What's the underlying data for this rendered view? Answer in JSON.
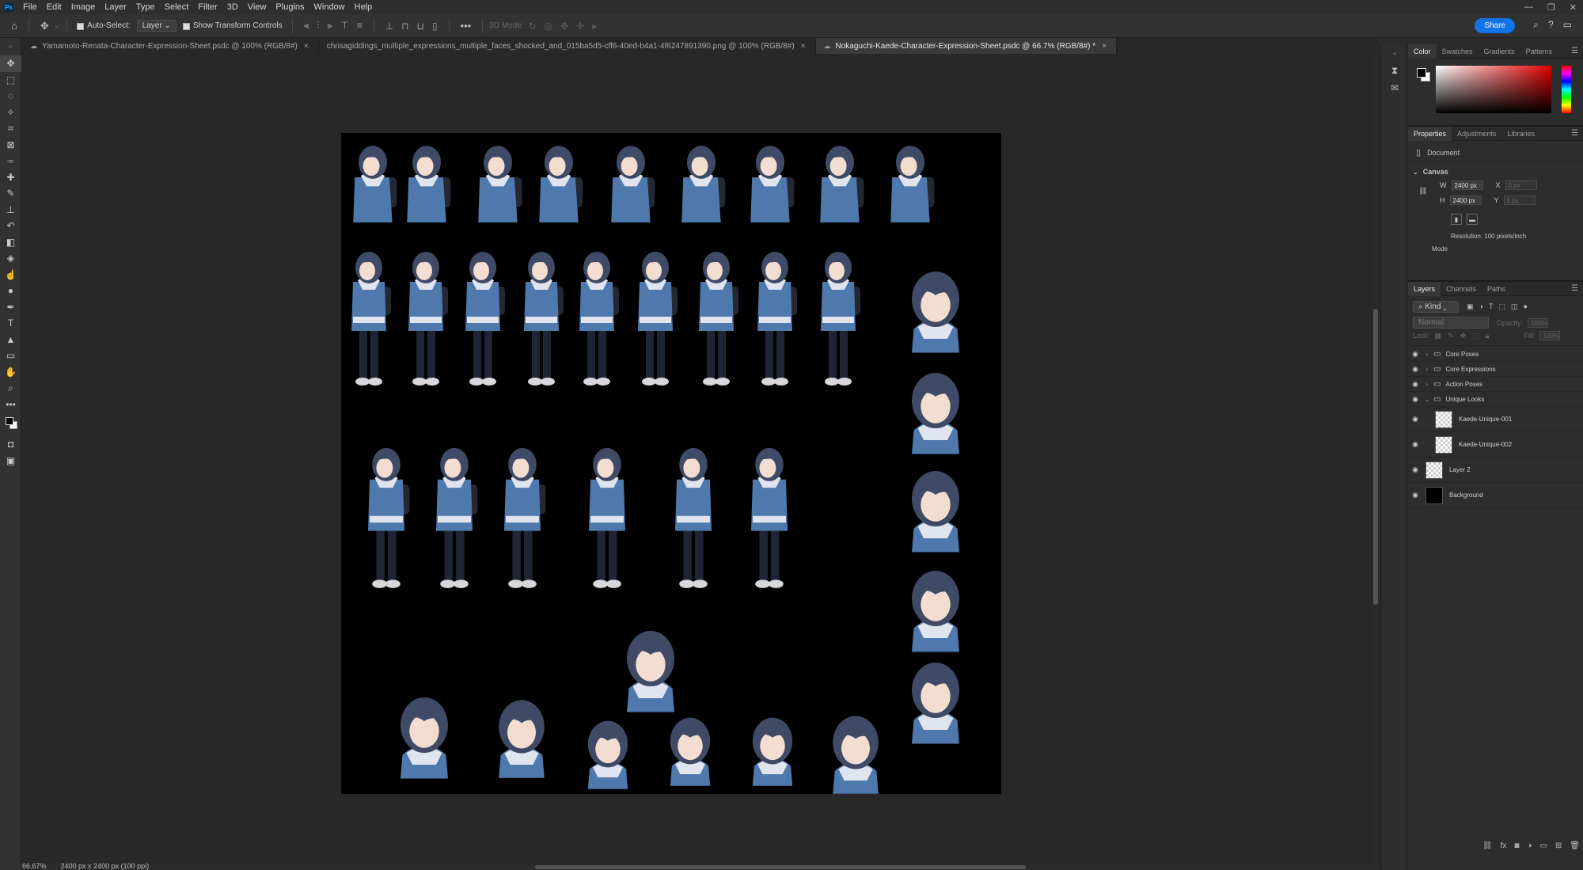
{
  "menu": [
    "File",
    "Edit",
    "Image",
    "Layer",
    "Type",
    "Select",
    "Filter",
    "3D",
    "View",
    "Plugins",
    "Window",
    "Help"
  ],
  "options": {
    "auto_select_label": "Auto-Select:",
    "auto_select_value": "Layer",
    "transform_label": "Show Transform Controls",
    "mode_3d": "3D Mode:",
    "share_label": "Share"
  },
  "tabs": [
    {
      "label": "Yamamoto-Renata-Character-Expression-Sheet.psdc @ 100% (RGB/8#)",
      "close": "×"
    },
    {
      "label": "chrisagiddings_multiple_expressions_multiple_faces_shocked_and_015ba5d5-cff6-40ed-b4a1-4f6247891390.png @ 100% (RGB/8#)",
      "close": "×"
    },
    {
      "label": "Nokaguchi-Kaede-Character-Expression-Sheet.psdc @ 66.7% (RGB/8#) *",
      "close": "×"
    }
  ],
  "status": {
    "zoom": "66.67%",
    "doc_info": "2400 px x 2400 px (100 ppi)"
  },
  "color_panel": {
    "tabs": [
      "Color",
      "Swatches",
      "Gradients",
      "Patterns"
    ]
  },
  "properties_panel": {
    "tabs": [
      "Properties",
      "Adjustments",
      "Libraries"
    ],
    "doc_label": "Document",
    "section": "Canvas",
    "w_label": "W",
    "w_value": "2400 px",
    "h_label": "H",
    "h_value": "2400 px",
    "x_label": "X",
    "x_value": "0 px",
    "y_label": "Y",
    "y_value": "0 px",
    "resolution": "Resolution: 100 pixels/inch",
    "mode_label": "Mode"
  },
  "layers_panel": {
    "tabs": [
      "Layers",
      "Channels",
      "Paths"
    ],
    "filter_kind": "Kind",
    "blend_mode": "Normal",
    "opacity_label": "Opacity:",
    "opacity_value": "100%",
    "lock_label": "Lock:",
    "fill_label": "Fill:",
    "fill_value": "100%",
    "layers": [
      {
        "name": "Core Poses",
        "type": "group"
      },
      {
        "name": "Core Expressions",
        "type": "group"
      },
      {
        "name": "Action Poses",
        "type": "group"
      },
      {
        "name": "Unique Looks",
        "type": "group-open"
      },
      {
        "name": "Kaede-Unique-001",
        "type": "child"
      },
      {
        "name": "Kaede-Unique-002",
        "type": "child"
      },
      {
        "name": "Layer 2",
        "type": "layer"
      },
      {
        "name": "Background",
        "type": "background"
      }
    ]
  },
  "colors": {
    "accent": "#1473e6",
    "canvas_bg": "#000000",
    "hair": "#3f4a66",
    "jacket": "#4f78ad"
  }
}
